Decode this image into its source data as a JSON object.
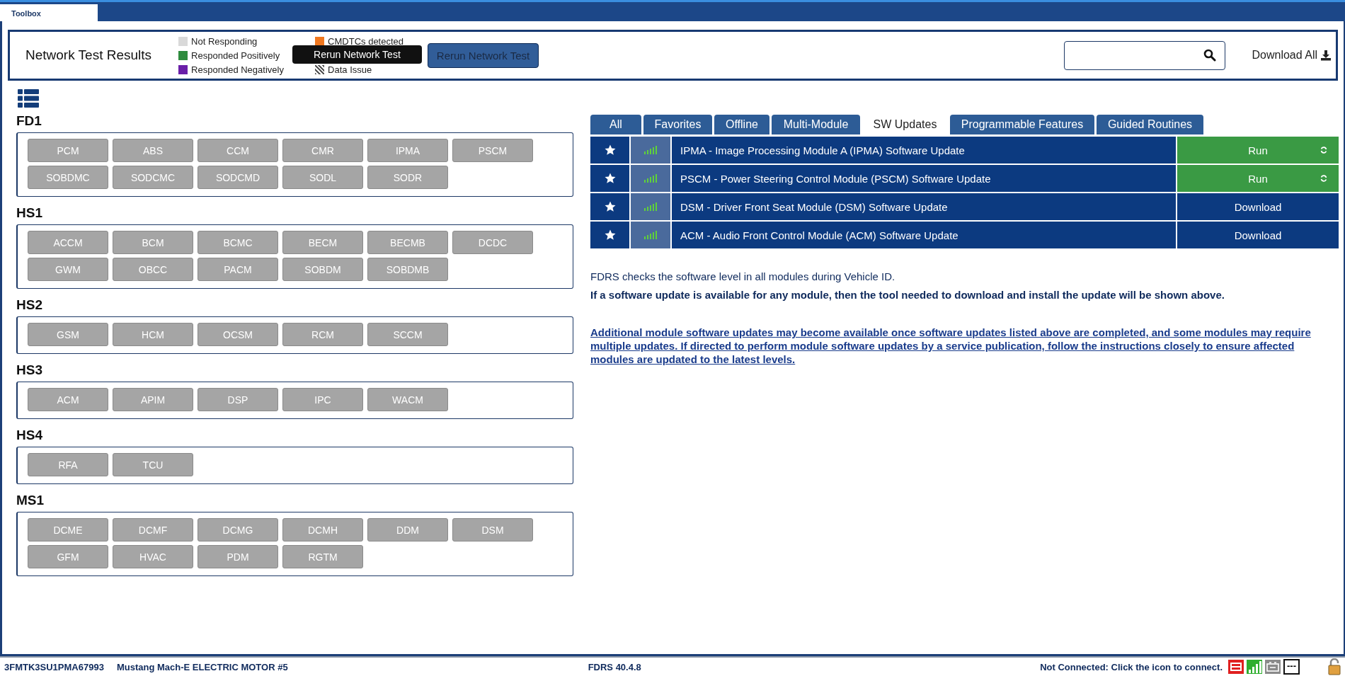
{
  "window_tab": {
    "label": "Toolbox",
    "selected": true
  },
  "header": {
    "title": "Network Test Results",
    "legend": [
      {
        "label": "Not Responding",
        "color": "#d9d9d9",
        "kind": "solid"
      },
      {
        "label": "Responded Positively",
        "color": "#2e8b3e",
        "kind": "solid"
      },
      {
        "label": "Responded Negatively",
        "color": "#6a1fa8",
        "kind": "solid"
      },
      {
        "label": "CMDTCs detected",
        "color": "#f07820",
        "kind": "solid"
      },
      {
        "label": "Data Issue",
        "color": "#555555",
        "kind": "hatched"
      }
    ],
    "tooltip": "Rerun Network Test",
    "rerun_button": "Rerun Network Test",
    "download_all": "Download All"
  },
  "groups": [
    {
      "name": "FD1",
      "modules": [
        "PCM",
        "ABS",
        "CCM",
        "CMR",
        "IPMA",
        "PSCM",
        "SOBDMC",
        "SODCMC",
        "SODCMD",
        "SODL",
        "SODR"
      ]
    },
    {
      "name": "HS1",
      "modules": [
        "ACCM",
        "BCM",
        "BCMC",
        "BECM",
        "BECMB",
        "DCDC",
        "GWM",
        "OBCC",
        "PACM",
        "SOBDM",
        "SOBDMB"
      ]
    },
    {
      "name": "HS2",
      "modules": [
        "GSM",
        "HCM",
        "OCSM",
        "RCM",
        "SCCM"
      ]
    },
    {
      "name": "HS3",
      "modules": [
        "ACM",
        "APIM",
        "DSP",
        "IPC",
        "WACM"
      ]
    },
    {
      "name": "HS4",
      "modules": [
        "RFA",
        "TCU"
      ]
    },
    {
      "name": "MS1",
      "modules": [
        "DCME",
        "DCMF",
        "DCMG",
        "DCMH",
        "DDM",
        "DSM",
        "GFM",
        "HVAC",
        "PDM",
        "RGTM"
      ]
    }
  ],
  "tabs": [
    {
      "label": "All",
      "selected": false
    },
    {
      "label": "Favorites",
      "selected": false
    },
    {
      "label": "Offline",
      "selected": false
    },
    {
      "label": "Multi-Module",
      "selected": false
    },
    {
      "label": "SW Updates",
      "selected": true
    },
    {
      "label": "Programmable Features",
      "selected": false
    },
    {
      "label": "Guided Routines",
      "selected": false
    }
  ],
  "updates": [
    {
      "title": "IPMA - Image Processing Module A (IPMA) Software Update",
      "action": {
        "label": "Run",
        "kind": "run"
      }
    },
    {
      "title": "PSCM - Power Steering Control Module (PSCM) Software Update",
      "action": {
        "label": "Run",
        "kind": "run"
      }
    },
    {
      "title": "DSM - Driver Front Seat Module (DSM) Software Update",
      "action": {
        "label": "Download",
        "kind": "download"
      }
    },
    {
      "title": "ACM - Audio Front Control Module (ACM) Software Update",
      "action": {
        "label": "Download",
        "kind": "download"
      }
    }
  ],
  "notes": [
    {
      "text": "FDRS checks the software level in all modules during Vehicle ID.",
      "kind": "plain"
    },
    {
      "text": "If a software update is available for any module, then the tool needed to download and install the update will be shown above.",
      "kind": "bold"
    },
    {
      "text": "Additional module software updates may become available once software updates listed above are completed, and some modules may require multiple updates. If directed to perform module software updates by a service publication, follow the instructions closely to ensure affected modules are updated to the latest levels.",
      "kind": "link"
    }
  ],
  "status_bar": {
    "vin": "3FMTK3SU1PMA67993",
    "vehicle": "Mustang Mach-E ELECTRIC MOTOR #5",
    "version": "FDRS 40.4.8",
    "connection": "Not Connected: Click the icon to connect.",
    "indicator": "---"
  }
}
